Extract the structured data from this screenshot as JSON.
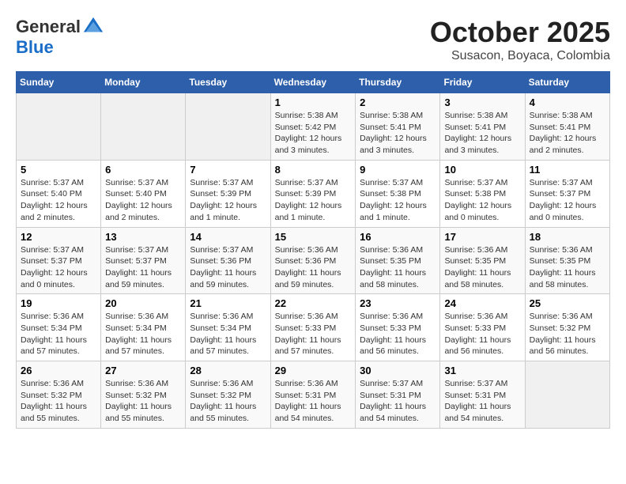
{
  "header": {
    "logo_general": "General",
    "logo_blue": "Blue",
    "month": "October 2025",
    "location": "Susacon, Boyaca, Colombia"
  },
  "days_of_week": [
    "Sunday",
    "Monday",
    "Tuesday",
    "Wednesday",
    "Thursday",
    "Friday",
    "Saturday"
  ],
  "weeks": [
    [
      {
        "day": "",
        "info": ""
      },
      {
        "day": "",
        "info": ""
      },
      {
        "day": "",
        "info": ""
      },
      {
        "day": "1",
        "info": "Sunrise: 5:38 AM\nSunset: 5:42 PM\nDaylight: 12 hours\nand 3 minutes."
      },
      {
        "day": "2",
        "info": "Sunrise: 5:38 AM\nSunset: 5:41 PM\nDaylight: 12 hours\nand 3 minutes."
      },
      {
        "day": "3",
        "info": "Sunrise: 5:38 AM\nSunset: 5:41 PM\nDaylight: 12 hours\nand 3 minutes."
      },
      {
        "day": "4",
        "info": "Sunrise: 5:38 AM\nSunset: 5:41 PM\nDaylight: 12 hours\nand 2 minutes."
      }
    ],
    [
      {
        "day": "5",
        "info": "Sunrise: 5:37 AM\nSunset: 5:40 PM\nDaylight: 12 hours\nand 2 minutes."
      },
      {
        "day": "6",
        "info": "Sunrise: 5:37 AM\nSunset: 5:40 PM\nDaylight: 12 hours\nand 2 minutes."
      },
      {
        "day": "7",
        "info": "Sunrise: 5:37 AM\nSunset: 5:39 PM\nDaylight: 12 hours\nand 1 minute."
      },
      {
        "day": "8",
        "info": "Sunrise: 5:37 AM\nSunset: 5:39 PM\nDaylight: 12 hours\nand 1 minute."
      },
      {
        "day": "9",
        "info": "Sunrise: 5:37 AM\nSunset: 5:38 PM\nDaylight: 12 hours\nand 1 minute."
      },
      {
        "day": "10",
        "info": "Sunrise: 5:37 AM\nSunset: 5:38 PM\nDaylight: 12 hours\nand 0 minutes."
      },
      {
        "day": "11",
        "info": "Sunrise: 5:37 AM\nSunset: 5:37 PM\nDaylight: 12 hours\nand 0 minutes."
      }
    ],
    [
      {
        "day": "12",
        "info": "Sunrise: 5:37 AM\nSunset: 5:37 PM\nDaylight: 12 hours\nand 0 minutes."
      },
      {
        "day": "13",
        "info": "Sunrise: 5:37 AM\nSunset: 5:37 PM\nDaylight: 11 hours\nand 59 minutes."
      },
      {
        "day": "14",
        "info": "Sunrise: 5:37 AM\nSunset: 5:36 PM\nDaylight: 11 hours\nand 59 minutes."
      },
      {
        "day": "15",
        "info": "Sunrise: 5:36 AM\nSunset: 5:36 PM\nDaylight: 11 hours\nand 59 minutes."
      },
      {
        "day": "16",
        "info": "Sunrise: 5:36 AM\nSunset: 5:35 PM\nDaylight: 11 hours\nand 58 minutes."
      },
      {
        "day": "17",
        "info": "Sunrise: 5:36 AM\nSunset: 5:35 PM\nDaylight: 11 hours\nand 58 minutes."
      },
      {
        "day": "18",
        "info": "Sunrise: 5:36 AM\nSunset: 5:35 PM\nDaylight: 11 hours\nand 58 minutes."
      }
    ],
    [
      {
        "day": "19",
        "info": "Sunrise: 5:36 AM\nSunset: 5:34 PM\nDaylight: 11 hours\nand 57 minutes."
      },
      {
        "day": "20",
        "info": "Sunrise: 5:36 AM\nSunset: 5:34 PM\nDaylight: 11 hours\nand 57 minutes."
      },
      {
        "day": "21",
        "info": "Sunrise: 5:36 AM\nSunset: 5:34 PM\nDaylight: 11 hours\nand 57 minutes."
      },
      {
        "day": "22",
        "info": "Sunrise: 5:36 AM\nSunset: 5:33 PM\nDaylight: 11 hours\nand 57 minutes."
      },
      {
        "day": "23",
        "info": "Sunrise: 5:36 AM\nSunset: 5:33 PM\nDaylight: 11 hours\nand 56 minutes."
      },
      {
        "day": "24",
        "info": "Sunrise: 5:36 AM\nSunset: 5:33 PM\nDaylight: 11 hours\nand 56 minutes."
      },
      {
        "day": "25",
        "info": "Sunrise: 5:36 AM\nSunset: 5:32 PM\nDaylight: 11 hours\nand 56 minutes."
      }
    ],
    [
      {
        "day": "26",
        "info": "Sunrise: 5:36 AM\nSunset: 5:32 PM\nDaylight: 11 hours\nand 55 minutes."
      },
      {
        "day": "27",
        "info": "Sunrise: 5:36 AM\nSunset: 5:32 PM\nDaylight: 11 hours\nand 55 minutes."
      },
      {
        "day": "28",
        "info": "Sunrise: 5:36 AM\nSunset: 5:32 PM\nDaylight: 11 hours\nand 55 minutes."
      },
      {
        "day": "29",
        "info": "Sunrise: 5:36 AM\nSunset: 5:31 PM\nDaylight: 11 hours\nand 54 minutes."
      },
      {
        "day": "30",
        "info": "Sunrise: 5:37 AM\nSunset: 5:31 PM\nDaylight: 11 hours\nand 54 minutes."
      },
      {
        "day": "31",
        "info": "Sunrise: 5:37 AM\nSunset: 5:31 PM\nDaylight: 11 hours\nand 54 minutes."
      },
      {
        "day": "",
        "info": ""
      }
    ]
  ]
}
